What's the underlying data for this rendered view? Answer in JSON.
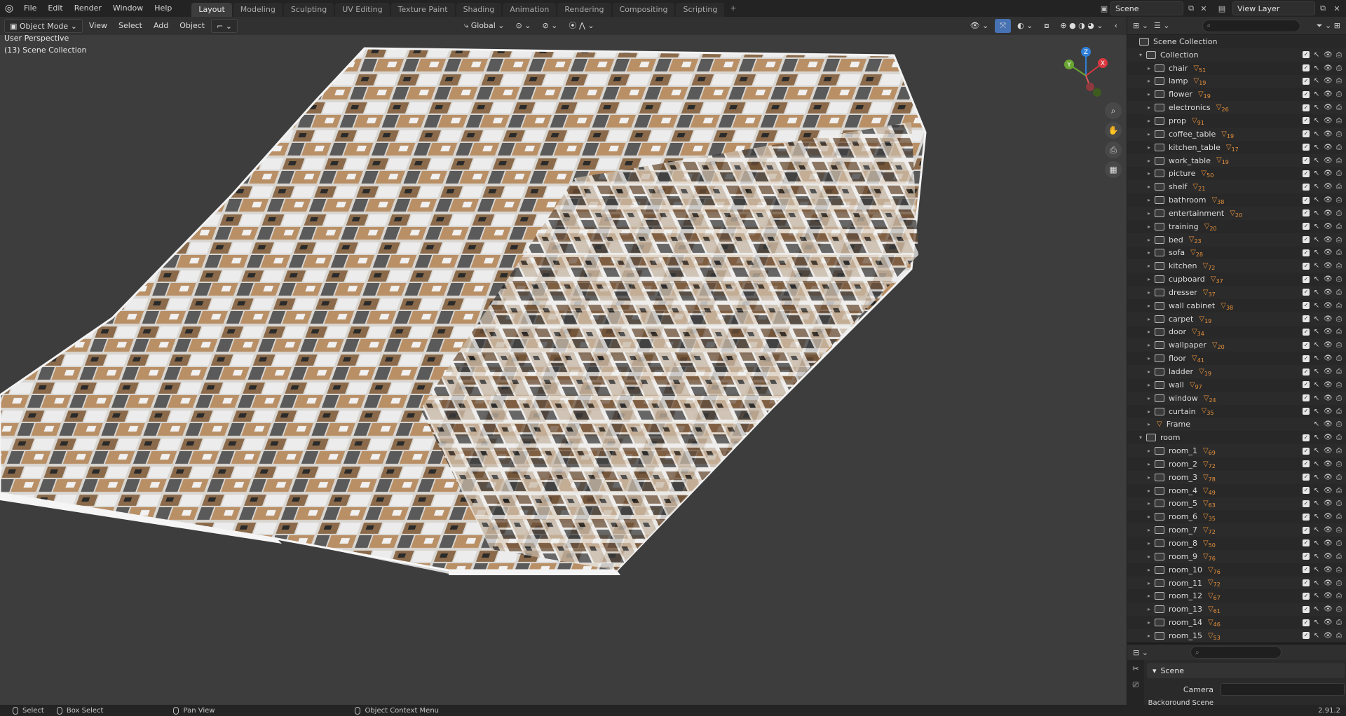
{
  "topbar": {
    "menus": [
      "File",
      "Edit",
      "Render",
      "Window",
      "Help"
    ],
    "workspaces": [
      "Layout",
      "Modeling",
      "Sculpting",
      "UV Editing",
      "Texture Paint",
      "Shading",
      "Animation",
      "Rendering",
      "Compositing",
      "Scripting"
    ],
    "active_workspace": "Layout",
    "scene_name": "Scene",
    "view_layer": "View Layer"
  },
  "viewport": {
    "mode": "Object Mode",
    "menus": [
      "View",
      "Select",
      "Add",
      "Object"
    ],
    "transform_orientation": "Global",
    "perspective_label": "User Perspective",
    "collection_label": "(13) Scene Collection",
    "axes": {
      "x": "X",
      "y": "Y",
      "z": "Z"
    }
  },
  "outliner": {
    "root": "Scene Collection",
    "collections": [
      {
        "name": "Collection",
        "children": [
          {
            "name": "chair",
            "count": "51"
          },
          {
            "name": "lamp",
            "count": "19"
          },
          {
            "name": "flower",
            "count": "19"
          },
          {
            "name": "electronics",
            "count": "26"
          },
          {
            "name": "prop",
            "count": "91"
          },
          {
            "name": "coffee_table",
            "count": "19"
          },
          {
            "name": "kitchen_table",
            "count": "17"
          },
          {
            "name": "work_table",
            "count": "19"
          },
          {
            "name": "picture",
            "count": "50"
          },
          {
            "name": "shelf",
            "count": "21"
          },
          {
            "name": "bathroom",
            "count": "38"
          },
          {
            "name": "entertainment",
            "count": "20"
          },
          {
            "name": "training",
            "count": "20"
          },
          {
            "name": "bed",
            "count": "23"
          },
          {
            "name": "sofa",
            "count": "28"
          },
          {
            "name": "kitchen",
            "count": "72"
          },
          {
            "name": "cupboard",
            "count": "37"
          },
          {
            "name": "dresser",
            "count": "37"
          },
          {
            "name": "wall cabinet",
            "count": "38"
          },
          {
            "name": "carpet",
            "count": "19"
          },
          {
            "name": "door",
            "count": "34"
          },
          {
            "name": "wallpaper",
            "count": "20"
          },
          {
            "name": "floor",
            "count": "41"
          },
          {
            "name": "ladder",
            "count": "19"
          },
          {
            "name": "wall",
            "count": "97"
          },
          {
            "name": "window",
            "count": "24"
          },
          {
            "name": "curtain",
            "count": "35"
          },
          {
            "name": "Frame",
            "count": ""
          }
        ]
      },
      {
        "name": "room",
        "children": [
          {
            "name": "room_1",
            "count": "69"
          },
          {
            "name": "room_2",
            "count": "72"
          },
          {
            "name": "room_3",
            "count": "78"
          },
          {
            "name": "room_4",
            "count": "49"
          },
          {
            "name": "room_5",
            "count": "63"
          },
          {
            "name": "room_6",
            "count": "35"
          },
          {
            "name": "room_7",
            "count": "72"
          },
          {
            "name": "room_8",
            "count": "50"
          },
          {
            "name": "room_9",
            "count": "76"
          },
          {
            "name": "room_10",
            "count": "76"
          },
          {
            "name": "room_11",
            "count": "72"
          },
          {
            "name": "room_12",
            "count": "67"
          },
          {
            "name": "room_13",
            "count": "61"
          },
          {
            "name": "room_14",
            "count": "46"
          },
          {
            "name": "room_15",
            "count": "53"
          }
        ]
      }
    ]
  },
  "properties": {
    "panel": "Scene",
    "camera_label": "Camera",
    "background_label": "Background Scene"
  },
  "statusbar": {
    "items": [
      "Select",
      "Box Select",
      "Pan View",
      "Object Context Menu"
    ],
    "version": "2.91.2"
  },
  "colors": {
    "accent_orange": "#e8923c",
    "active_tab": "#3d3d3d",
    "viewport_bg": "#3d3d3d"
  }
}
